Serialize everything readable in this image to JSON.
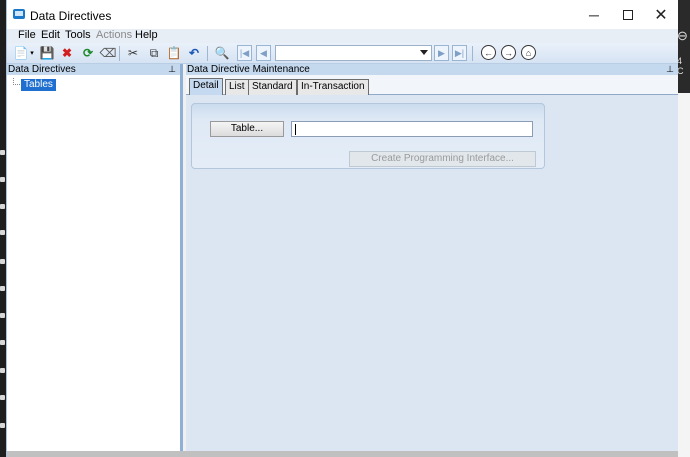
{
  "window": {
    "title": "Data Directives"
  },
  "window_controls": {
    "minimize": "─",
    "maximize": "",
    "close": "✕"
  },
  "menu": [
    {
      "label": "File",
      "enabled": true
    },
    {
      "label": "Edit",
      "enabled": true
    },
    {
      "label": "Tools",
      "enabled": true
    },
    {
      "label": "Actions",
      "enabled": false
    },
    {
      "label": "Help",
      "enabled": true
    }
  ],
  "toolbar": {
    "record_selector_value": "",
    "icons": {
      "new": "📄",
      "save": "💾",
      "delete": "✖",
      "refresh": "⟳",
      "clear": "⌫",
      "cut": "✂",
      "copy": "⧉",
      "paste": "📋",
      "undo": "↶",
      "find": "🔍",
      "first": "|◀",
      "prev": "◀",
      "next": "▶",
      "last": "▶|",
      "back": "←",
      "forward": "→",
      "home": "⌂"
    }
  },
  "left_pane": {
    "title": "Data Directives",
    "pin": "⊥",
    "tree": [
      {
        "label": "Tables",
        "selected": true
      }
    ]
  },
  "right_pane": {
    "title": "Data Directive Maintenance",
    "pin": "⊥",
    "tabs": [
      {
        "label": "Detail",
        "active": true
      },
      {
        "label": "List",
        "active": false
      },
      {
        "label": "Standard",
        "active": false
      },
      {
        "label": "In-Transaction",
        "active": false
      }
    ],
    "detail": {
      "table_button": "Table...",
      "table_value": "",
      "create_button": "Create Programming Interface..."
    }
  },
  "background": {
    "right_text_1": "⊖",
    "right_text_2": "4 C"
  },
  "colors": {
    "selection": "#1e6fcf",
    "pane_header": "#c4d8ee",
    "panel_bg": "#dce6f2"
  }
}
